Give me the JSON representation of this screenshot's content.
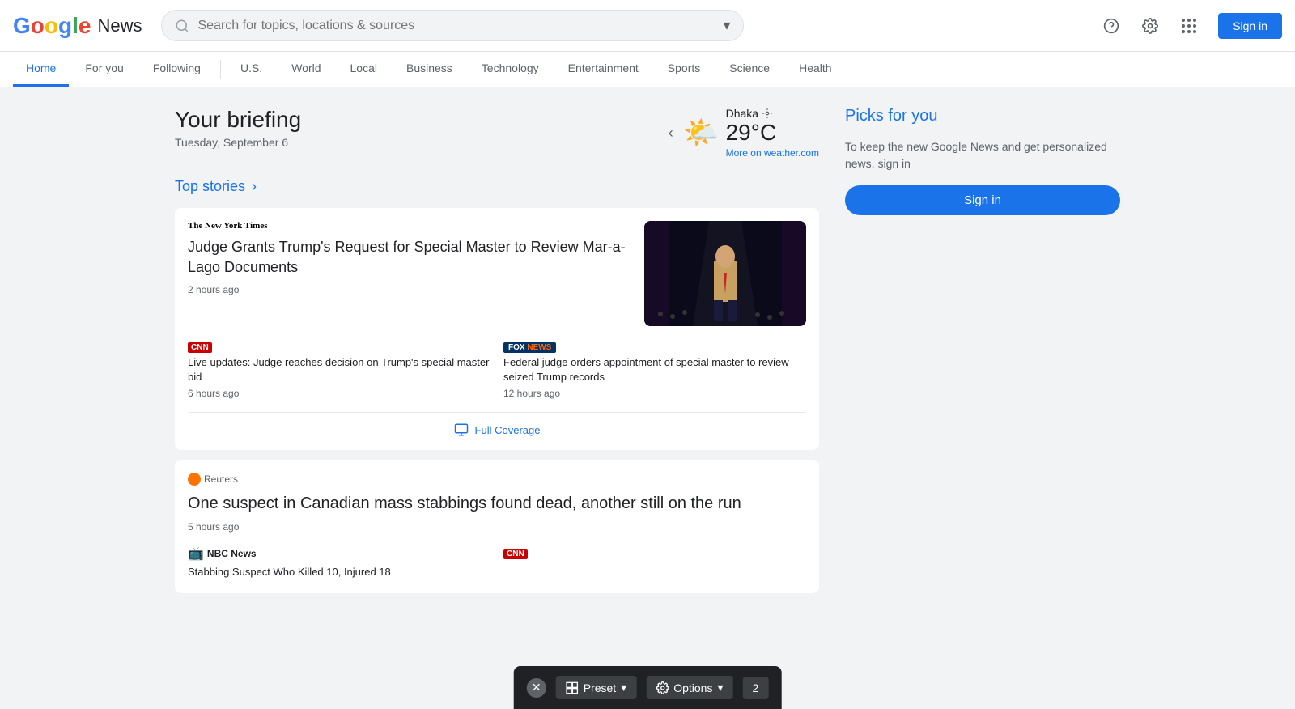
{
  "app": {
    "title": "Google News",
    "logo_text": "Google",
    "logo_news": "News"
  },
  "header": {
    "search_placeholder": "Search for topics, locations & sources",
    "sign_in_label": "Sign in"
  },
  "nav": {
    "items": [
      {
        "label": "Home",
        "active": true
      },
      {
        "label": "For you",
        "active": false
      },
      {
        "label": "Following",
        "active": false
      },
      {
        "label": "U.S.",
        "active": false
      },
      {
        "label": "World",
        "active": false
      },
      {
        "label": "Local",
        "active": false
      },
      {
        "label": "Business",
        "active": false
      },
      {
        "label": "Technology",
        "active": false
      },
      {
        "label": "Entertainment",
        "active": false
      },
      {
        "label": "Sports",
        "active": false
      },
      {
        "label": "Science",
        "active": false
      },
      {
        "label": "Health",
        "active": false
      }
    ]
  },
  "briefing": {
    "title": "Your briefing",
    "date": "Tuesday, September 6",
    "weather": {
      "city": "Dhaka",
      "temperature": "29°C",
      "weather_link": "More on weather.com"
    }
  },
  "top_stories": {
    "label": "Top stories",
    "article1": {
      "source": "The New York Times",
      "headline": "Judge Grants Trump's Request for Special Master to Review Mar-a-Lago Documents",
      "time": "2 hours ago",
      "sub_articles": [
        {
          "source_name": "CNN",
          "source_type": "cnn",
          "headline": "Live updates: Judge reaches decision on Trump's special master bid",
          "time": "6 hours ago"
        },
        {
          "source_name": "FOX NEWS",
          "source_type": "foxnews",
          "headline": "Federal judge orders appointment of special master to review seized Trump records",
          "time": "12 hours ago"
        }
      ],
      "full_coverage": "Full Coverage"
    },
    "article2": {
      "source": "Reuters",
      "source_type": "reuters",
      "headline": "One suspect in Canadian mass stabbings found dead, another still on the run",
      "time": "5 hours ago",
      "sub_articles": [
        {
          "source_name": "NBC News",
          "source_type": "nbc",
          "headline": "Stabbing Suspect Who Killed 10, Injured 18",
          "time": ""
        },
        {
          "source_name": "CNN",
          "source_type": "cnn",
          "headline": "",
          "time": ""
        }
      ]
    }
  },
  "sidebar": {
    "picks_title": "Picks for you",
    "picks_description": "To keep the new Google News and get personalized news, sign in",
    "sign_in_label": "Sign in"
  },
  "bottom_bar": {
    "preset_label": "Preset",
    "options_label": "Options",
    "count": "2"
  }
}
